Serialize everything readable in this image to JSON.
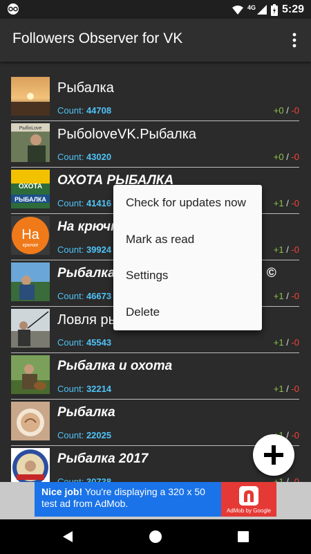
{
  "status_bar": {
    "network": "4G",
    "time": "5:29"
  },
  "app_bar": {
    "title": "Followers Observer for VK"
  },
  "list": {
    "count_label": "Count:",
    "slash": "/",
    "items": [
      {
        "title": "Рыбалка",
        "count": "44708",
        "plus": "+0",
        "minus": "-0",
        "italic": false
      },
      {
        "title": "РыбоloveVK.Рыбалка",
        "count": "43020",
        "plus": "+0",
        "minus": "-0",
        "italic": false
      },
      {
        "title": "ОХОТА РЫБАЛКА",
        "count": "41416",
        "plus": "+1",
        "minus": "-0",
        "italic": true
      },
      {
        "title": "На крючке",
        "count": "39924",
        "plus": "+1",
        "minus": "-0",
        "italic": true
      },
      {
        "title": "Рыбалка",
        "title_tail": "ь ©",
        "count": "46673",
        "plus": "+1",
        "minus": "-0",
        "italic": true
      },
      {
        "title": "Ловля ры",
        "count": "45543",
        "plus": "+1",
        "minus": "-0",
        "italic": false
      },
      {
        "title": "Рыбалка и охота",
        "count": "32214",
        "plus": "+1",
        "minus": "-0",
        "italic": true
      },
      {
        "title": "Рыбалка",
        "count": "22025",
        "plus": "+1",
        "minus": "-0",
        "italic": true
      },
      {
        "title": "Рыбалка 2017",
        "count": "30738",
        "plus": "+1",
        "minus": "-0",
        "italic": true
      }
    ],
    "thumb_badges": {
      "row1": "РыбоLove",
      "row2_top": "ОХОТА",
      "row2_bottom": "РЫБАЛКА",
      "row3_big": "На",
      "row3_small": "крючке"
    }
  },
  "context_menu": {
    "items": [
      "Check for updates now",
      "Mark as read",
      "Settings",
      "Delete"
    ]
  },
  "ad": {
    "headline": "Nice job!",
    "body": "You're displaying a 320 x 50 test ad from AdMob.",
    "logo_label": "AdMob by Google"
  },
  "colors": {
    "count": "#4fc3f7",
    "plus": "#8bc34a",
    "minus": "#f44336",
    "ad_blue": "#1a73e8",
    "ad_red": "#e53935"
  }
}
